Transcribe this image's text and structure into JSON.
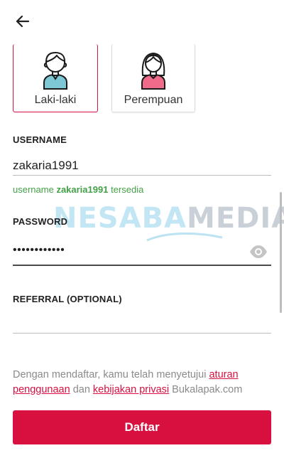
{
  "colors": {
    "accent": "#d7103f",
    "success": "#43a047",
    "muted_text": "#8a8a8a"
  },
  "header": {
    "back_icon": "arrow-left-icon"
  },
  "gender": {
    "options": [
      {
        "label": "Laki-laki",
        "icon": "male-avatar-icon",
        "selected": true
      },
      {
        "label": "Perempuan",
        "icon": "female-avatar-icon",
        "selected": false
      }
    ]
  },
  "username": {
    "label": "USERNAME",
    "value": "zakaria1991",
    "helper_prefix": "username",
    "helper_name": "zakaria1991",
    "helper_suffix": "tersedia"
  },
  "password": {
    "label": "PASSWORD",
    "value_masked": "••••••••••••",
    "toggle_icon": "eye-icon"
  },
  "referral": {
    "label": "REFERRAL (OPTIONAL)",
    "value": ""
  },
  "terms": {
    "prefix": "Dengan mendaftar, kamu telah menyetujui",
    "link1": "aturan penggunaan",
    "middle": "dan",
    "link2": "kebijakan privasi",
    "suffix": "Bukalapak.com"
  },
  "watermark": {
    "part1": "NESABA",
    "part2": "MEDIA"
  },
  "submit": {
    "label": "Daftar"
  }
}
